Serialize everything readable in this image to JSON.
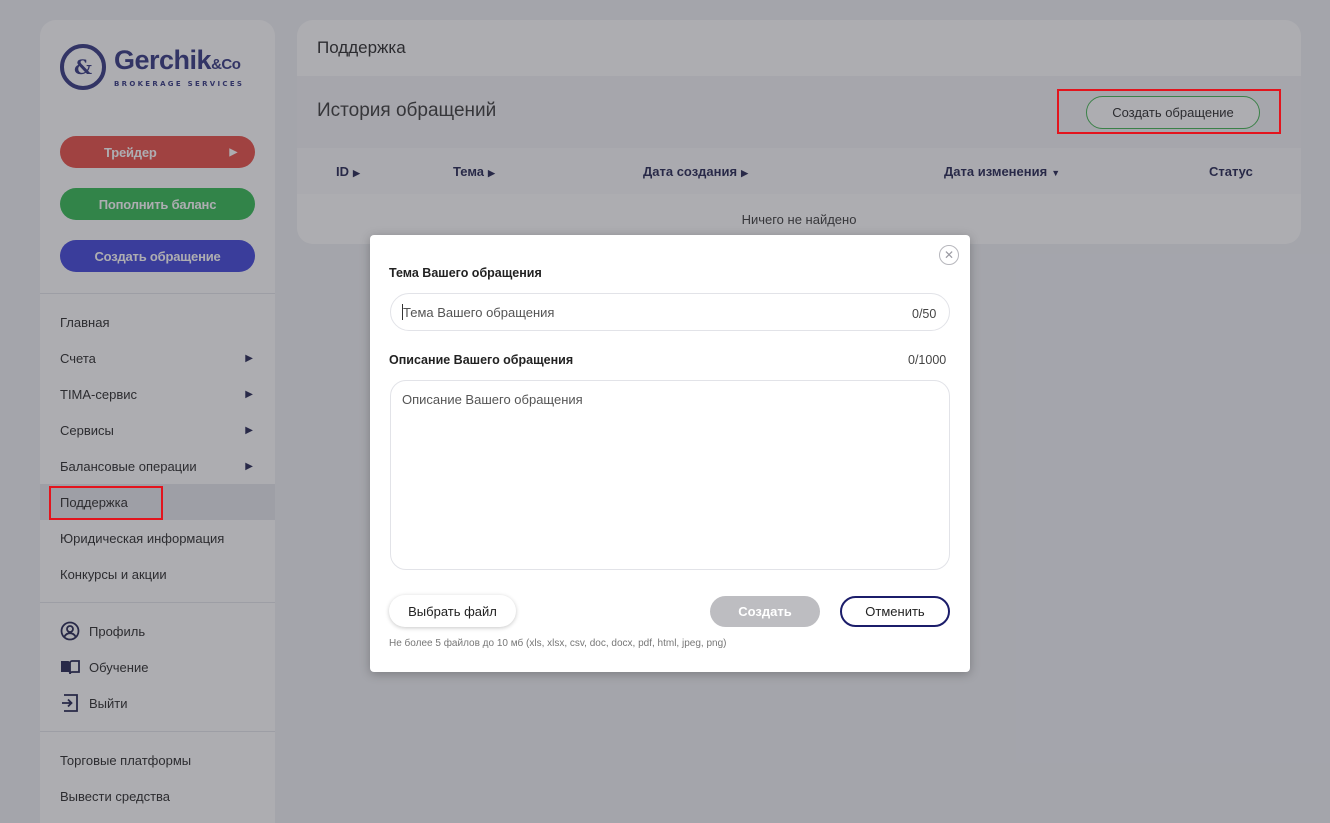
{
  "sidebar": {
    "logo": {
      "name": "Gerchik",
      "amp": "&Co",
      "tagline": "BROKERAGE SERVICES"
    },
    "buttons": {
      "trader": "Трейдер",
      "deposit": "Пополнить баланс",
      "create_ticket": "Создать обращение"
    },
    "menu": [
      {
        "label": "Главная"
      },
      {
        "label": "Счета"
      },
      {
        "label": "TIMA-сервис"
      },
      {
        "label": "Сервисы"
      },
      {
        "label": "Балансовые операции"
      },
      {
        "label": "Поддержка"
      },
      {
        "label": "Юридическая информация"
      },
      {
        "label": "Конкурсы и акции"
      }
    ],
    "account": [
      {
        "label": "Профиль",
        "icon": "user-icon"
      },
      {
        "label": "Обучение",
        "icon": "book-icon"
      },
      {
        "label": "Выйти",
        "icon": "logout-icon"
      }
    ],
    "extra": [
      {
        "label": "Торговые платформы"
      },
      {
        "label": "Вывести средства"
      }
    ]
  },
  "main": {
    "title": "Поддержка",
    "history_title": "История обращений",
    "create_button": "Создать обращение",
    "columns": [
      "ID",
      "Тема",
      "Дата создания",
      "Дата изменения",
      "Статус"
    ],
    "empty_text": "Ничего не найдено"
  },
  "modal": {
    "subject_label": "Тема Вашего обращения",
    "subject_placeholder": "Тема Вашего обращения",
    "subject_counter": "0/50",
    "description_label": "Описание Вашего обращения",
    "description_placeholder": "Описание Вашего обращения",
    "description_counter": "0/1000",
    "file_button": "Выбрать файл",
    "submit_button": "Создать",
    "cancel_button": "Отменить",
    "file_hint": "Не более 5 файлов до 10 мб (xls, xlsx, csv, doc, docx, pdf, html, jpeg, png)"
  },
  "colors": {
    "trader": "#e8483e",
    "deposit": "#2bb84d",
    "create_ticket": "#3a3ed9",
    "brand_navy": "#2b2f7d",
    "highlight_red": "#e3141d",
    "create_outline": "#3cb44b"
  }
}
